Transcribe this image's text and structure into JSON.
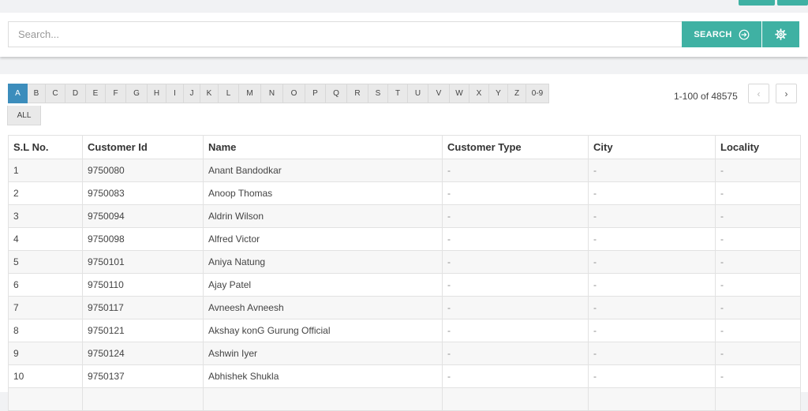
{
  "search": {
    "placeholder": "Search...",
    "button_label": "SEARCH"
  },
  "alphabet": [
    "A",
    "B",
    "C",
    "D",
    "E",
    "F",
    "G",
    "H",
    "I",
    "J",
    "K",
    "L",
    "M",
    "N",
    "O",
    "P",
    "Q",
    "R",
    "S",
    "T",
    "U",
    "V",
    "W",
    "X",
    "Y",
    "Z",
    "0-9"
  ],
  "alphabet_active": "A",
  "all_label": "ALL",
  "pager": {
    "range_text": "1-100 of 48575",
    "prev": "‹",
    "next": "›"
  },
  "table": {
    "headers": [
      "S.L No.",
      "Customer Id",
      "Name",
      "Customer Type",
      "City",
      "Locality"
    ],
    "rows": [
      [
        "1",
        "9750080",
        "Anant Bandodkar",
        "-",
        "-",
        "-"
      ],
      [
        "2",
        "9750083",
        "Anoop Thomas",
        "-",
        "-",
        "-"
      ],
      [
        "3",
        "9750094",
        "Aldrin Wilson",
        "-",
        "-",
        "-"
      ],
      [
        "4",
        "9750098",
        "Alfred Victor",
        "-",
        "-",
        "-"
      ],
      [
        "5",
        "9750101",
        "Aniya Natung",
        "-",
        "-",
        "-"
      ],
      [
        "6",
        "9750110",
        "Ajay Patel",
        "-",
        "-",
        "-"
      ],
      [
        "7",
        "9750117",
        "Avneesh Avneesh",
        "-",
        "-",
        "-"
      ],
      [
        "8",
        "9750121",
        "Akshay konG Gurung Official",
        "-",
        "-",
        "-"
      ],
      [
        "9",
        "9750124",
        "Ashwin Iyer",
        "-",
        "-",
        "-"
      ],
      [
        "10",
        "9750137",
        "Abhishek Shukla",
        "-",
        "-",
        "-"
      ],
      [
        "",
        "",
        "",
        "",
        "",
        ""
      ]
    ]
  },
  "colors": {
    "accent": "#3fb1a3",
    "active_letter": "#3c8dbc"
  },
  "icons": {
    "search_button": "arrow-circle-right-icon",
    "settings": "gear-icon"
  }
}
